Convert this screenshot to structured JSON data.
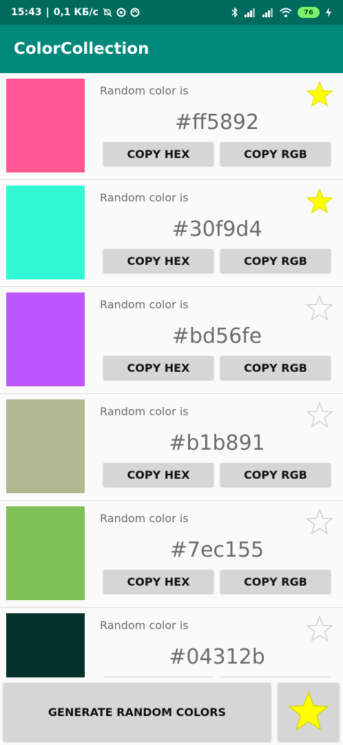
{
  "status_bar": {
    "time": "15:43",
    "net_speed": "0,1 КБ/с",
    "battery": "76"
  },
  "app": {
    "title": "ColorCollection"
  },
  "colors": [
    {
      "label": "Random color is",
      "hex": "#ff5892",
      "favorite": true
    },
    {
      "label": "Random color is",
      "hex": "#30f9d4",
      "favorite": true
    },
    {
      "label": "Random color is",
      "hex": "#bd56fe",
      "favorite": false
    },
    {
      "label": "Random color is",
      "hex": "#b1b891",
      "favorite": false
    },
    {
      "label": "Random color is",
      "hex": "#7ec155",
      "favorite": false
    },
    {
      "label": "Random color is",
      "hex": "#04312b",
      "favorite": false
    }
  ],
  "buttons": {
    "copy_hex": "COPY HEX",
    "copy_rgb": "COPY RGB",
    "generate": "GENERATE RANDOM COLORS"
  },
  "theme": {
    "primary": "#00897b",
    "primary_dark": "#006a5e",
    "star_fill": "#ffff00",
    "star_outline": "#c8c8c8"
  }
}
